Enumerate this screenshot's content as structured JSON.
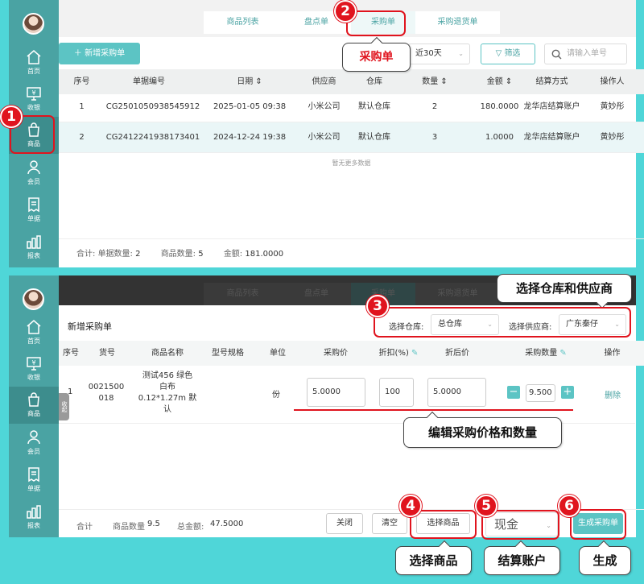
{
  "nav": {
    "home": "首页",
    "cashier": "收银",
    "products": "商品",
    "members": "会员",
    "orders": "单据",
    "reports": "报表",
    "collapse": "收起"
  },
  "tabs": {
    "product_list": "商品列表",
    "inventory": "盘点单",
    "purchase": "采购单",
    "purchase_return": "采购退货单"
  },
  "toolbar": {
    "new_purchase": "新增采购单",
    "date_range": "近30天",
    "filter": "筛选",
    "search_placeholder": "请输入单号"
  },
  "table": {
    "headers": [
      "序号",
      "单据编号",
      "日期",
      "供应商",
      "仓库",
      "数量",
      "金额",
      "结算方式",
      "操作人"
    ],
    "rows": [
      [
        "1",
        "CG2501050938545912",
        "2025-01-05 09:38",
        "小米公司",
        "默认仓库",
        "2",
        "180.0000",
        "龙华店结算账户",
        "黄妙彤"
      ],
      [
        "2",
        "CG2412241938173401",
        "2024-12-24 19:38",
        "小米公司",
        "默认仓库",
        "3",
        "1.0000",
        "龙华店结算账户",
        "黄妙彤"
      ]
    ],
    "no_more": "暂无更多数据"
  },
  "summary": {
    "total_label": "合计:",
    "docs_label": "单据数量:",
    "docs_value": "2",
    "qty_label": "商品数量:",
    "qty_value": "5",
    "amount_label": "金额:",
    "amount_value": "181.0000"
  },
  "form": {
    "title": "新增采购单",
    "warehouse_label": "选择仓库:",
    "warehouse_value": "总仓库",
    "supplier_label": "选择供应商:",
    "supplier_value": "广东秦仔",
    "headers": [
      "序号",
      "货号",
      "商品名称",
      "型号规格",
      "单位",
      "采购价",
      "折扣(%)",
      "折后价",
      "采购数量",
      "操作"
    ],
    "item": {
      "index": "1",
      "code_line1": "0021500",
      "code_line2": "018",
      "name_line1": "测试456 绿色",
      "name_line2": "白布",
      "name_line3": "0.12*1.27m 默",
      "name_line4": "认",
      "unit": "份",
      "price": "5.0000",
      "discount": "100",
      "discounted_price": "5.0000",
      "quantity": "9.500",
      "delete": "删除"
    },
    "footer": {
      "total": "合计",
      "qty_label": "商品数量",
      "qty_value": "9.5",
      "amount_label": "总金额:",
      "amount_value": "47.5000",
      "close": "关闭",
      "clear": "清空",
      "select_goods": "选择商品",
      "payment": "现金",
      "generate": "生成采购单"
    }
  },
  "annotations": {
    "n1": "1",
    "n2": "2",
    "n3": "3",
    "n4": "4",
    "n5": "5",
    "n6": "6",
    "purchase": "采购单",
    "select_wh_supplier": "选择仓库和供应商",
    "edit_price_qty": "编辑采购价格和数量",
    "select_goods": "选择商品",
    "settlement_account": "结算账户",
    "generate": "生成"
  },
  "colors": {
    "teal": "#4aa3a3",
    "accent": "#5cc4c4",
    "background": "#4fd6d8",
    "annotation_red": "#e0141e"
  }
}
